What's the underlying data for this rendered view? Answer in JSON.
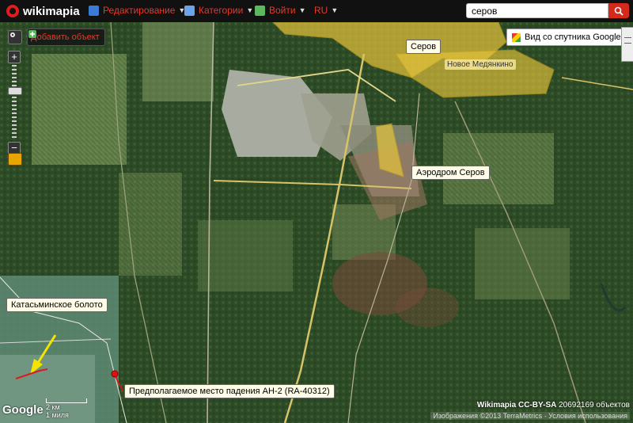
{
  "header": {
    "logo_text": "wikimapia",
    "menu": [
      {
        "label": "Редактирование",
        "icon": "edit-icon"
      },
      {
        "label": "Категории",
        "icon": "categories-icon"
      },
      {
        "label": "Войти",
        "icon": "login-icon"
      },
      {
        "label": "RU",
        "icon": ""
      }
    ],
    "search_value": "серов",
    "search_icon": "search-icon"
  },
  "map_controls": {
    "add_object_label": "Добавить объект",
    "zoom_in": "+",
    "zoom_out": "−",
    "satellite_label": "Вид со спутника Google"
  },
  "labels": {
    "serov": "Серов",
    "novoe": "Новое Медянкино",
    "airport": "Аэродром Серов",
    "bog": "Катасьминское болото",
    "crash": "Предполагаемое место падения АН-2 (RA-40312)"
  },
  "footer": {
    "google": "Google",
    "scale_km": "2 км",
    "scale_mi": "1 миля",
    "wikimapia_license": "Wikimapia CC-BY-SA",
    "objects_count": "20692169 объектов",
    "attribution": "Изображения ©2013 TerraMetrics · Условия использования"
  },
  "colors": {
    "accent": "#e53a2a",
    "settlement_fill": "#e6c43c",
    "annotation_arrow": "#f5e400",
    "crash_marker": "#e01010"
  }
}
